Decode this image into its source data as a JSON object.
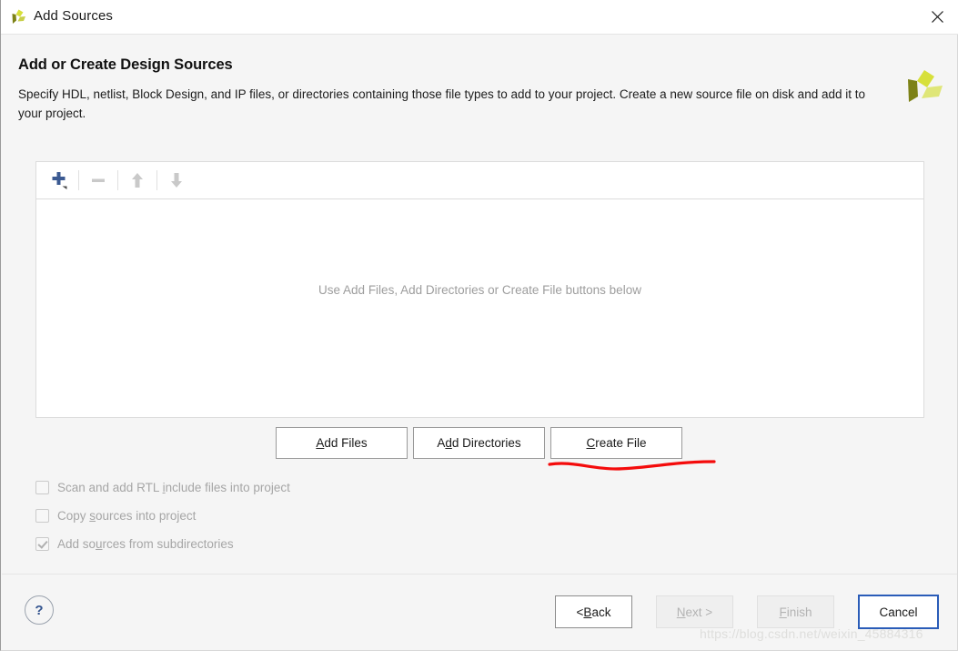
{
  "titlebar": {
    "title": "Add Sources",
    "logo_icon": "vivado-logo-icon",
    "close_icon": "close-icon"
  },
  "header": {
    "title": "Add or Create Design Sources",
    "description": "Specify HDL, netlist, Block Design, and IP files, or directories containing those file types to add to your project. Create a new source file on disk and add it to your project.",
    "logo_icon": "xilinx-logo-icon"
  },
  "panel": {
    "toolbar": [
      {
        "name": "add-icon",
        "glyph": "+",
        "enabled": true,
        "has_dropdown": true
      },
      {
        "name": "remove-icon",
        "glyph": "−",
        "enabled": false,
        "has_dropdown": false
      },
      {
        "name": "move-up-icon",
        "glyph": "↑",
        "enabled": false,
        "has_dropdown": false
      },
      {
        "name": "move-down-icon",
        "glyph": "↓",
        "enabled": false,
        "has_dropdown": false
      }
    ],
    "empty_message": "Use Add Files, Add Directories or Create File buttons below"
  },
  "actions": [
    {
      "label": "Add Files",
      "mnemonic_before": "",
      "mnemonic": "A",
      "mnemonic_after": "dd Files",
      "name": "add-files-button"
    },
    {
      "label": "Add Directories",
      "mnemonic_before": "A",
      "mnemonic": "d",
      "mnemonic_after": "d Directories",
      "name": "add-directories-button"
    },
    {
      "label": "Create File",
      "mnemonic_before": "",
      "mnemonic": "C",
      "mnemonic_after": "reate File",
      "name": "create-file-button"
    }
  ],
  "options": [
    {
      "label_before": "Scan and add RTL ",
      "mnemonic": "i",
      "label_after": "nclude files into project",
      "checked": false,
      "enabled": false,
      "name": "scan-rtl-include-checkbox"
    },
    {
      "label_before": "Copy ",
      "mnemonic": "s",
      "label_after": "ources into project",
      "checked": false,
      "enabled": false,
      "name": "copy-sources-checkbox"
    },
    {
      "label_before": "Add so",
      "mnemonic": "u",
      "label_after": "rces from subdirectories",
      "checked": true,
      "enabled": false,
      "name": "add-sources-subdirectories-checkbox"
    }
  ],
  "footer": {
    "help_label": "?",
    "buttons": [
      {
        "before": "< ",
        "mnemonic": "B",
        "after": "ack",
        "enabled": true,
        "focused": false,
        "name": "back-button"
      },
      {
        "before": "",
        "mnemonic": "N",
        "after": "ext >",
        "enabled": false,
        "focused": false,
        "name": "next-button"
      },
      {
        "before": "",
        "mnemonic": "F",
        "after": "inish",
        "enabled": false,
        "focused": false,
        "name": "finish-button"
      },
      {
        "before": "Cancel",
        "mnemonic": "",
        "after": "",
        "enabled": true,
        "focused": true,
        "name": "cancel-button"
      }
    ]
  },
  "watermark": "https://blog.csdn.net/weixin_45884316",
  "colors": {
    "accent_blue": "#2a5cb8",
    "toolbar_add": "#3b5a92",
    "annotation_red": "#f40b0b",
    "logo_olive": "#7d8217",
    "logo_yellow": "#d7e03a",
    "logo_light": "#dfe678",
    "disabled_text": "#a6a6a6"
  }
}
